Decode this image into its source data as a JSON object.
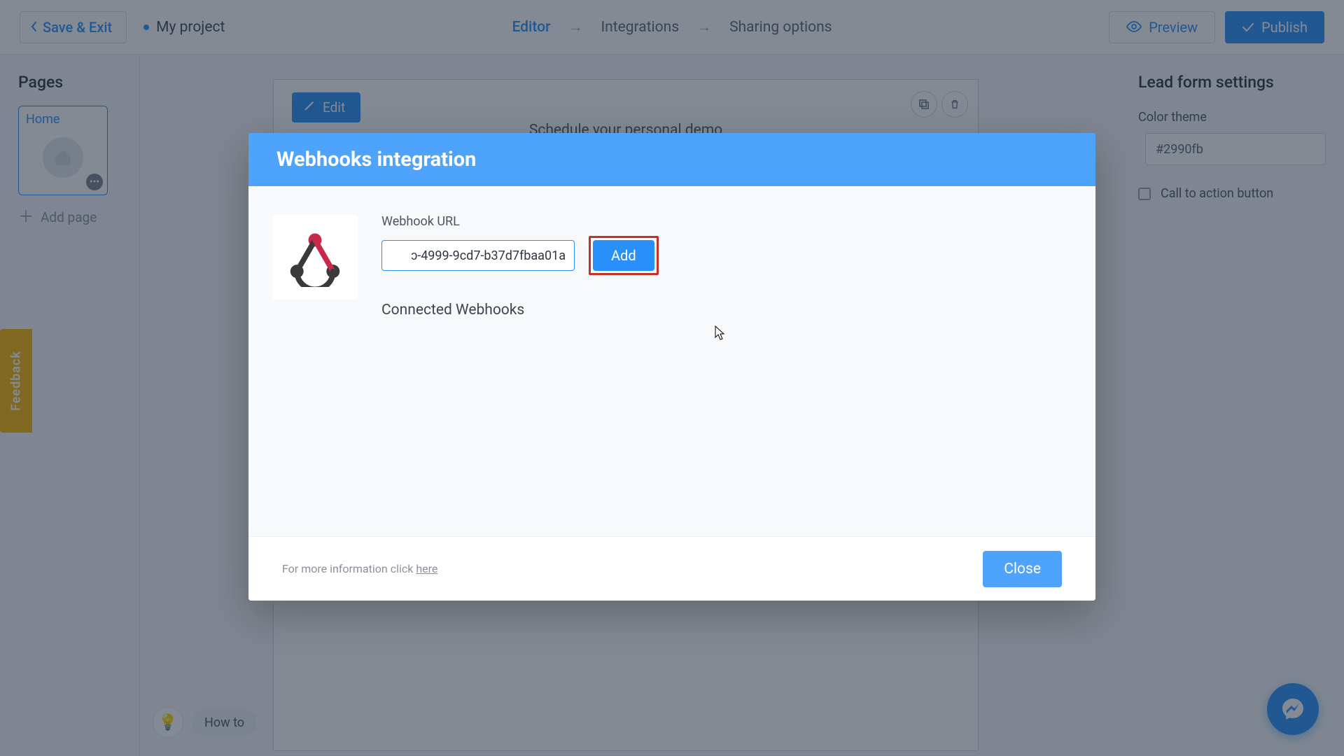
{
  "topbar": {
    "save_exit": "Save & Exit",
    "project_name": "My project",
    "nav": {
      "editor": "Editor",
      "integrations": "Integrations",
      "sharing": "Sharing options"
    },
    "preview": "Preview",
    "publish": "Publish"
  },
  "left": {
    "heading": "Pages",
    "page1": "Home",
    "add_page": "Add page"
  },
  "canvas": {
    "edit": "Edit",
    "title": "Schedule your personal demo"
  },
  "right": {
    "heading": "Lead form settings",
    "color_theme_label": "Color theme",
    "color_hex": "#2990fb",
    "cta_label": "Call to action button"
  },
  "feedback": "Feedback",
  "howto": "How to",
  "modal": {
    "title": "Webhooks integration",
    "url_label": "Webhook URL",
    "url_value": "ɔ-4999-9cd7-b37d7fbaa01a",
    "add": "Add",
    "connected": "Connected Webhooks",
    "footer_prefix": "For more information click ",
    "footer_link": "here",
    "close": "Close"
  }
}
